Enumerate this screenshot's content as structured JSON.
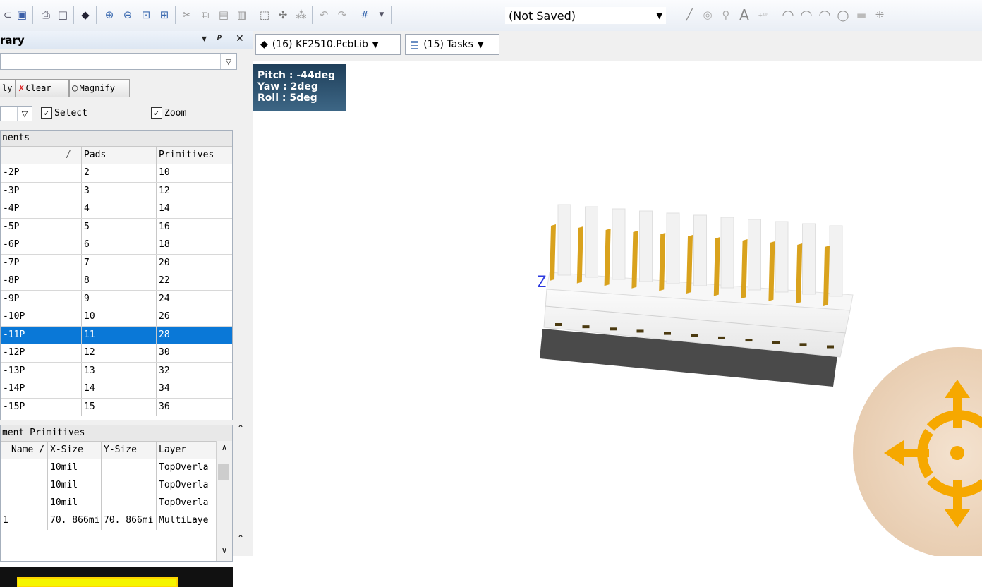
{
  "toolbar": {
    "saved_state": "(Not Saved)",
    "icons": [
      "open-icon",
      "save-icon",
      "print-icon",
      "print-preview-icon",
      "3d-body-icon",
      "zoom-in-icon",
      "zoom-out-icon",
      "zoom-fit-icon",
      "zoom-selected-icon",
      "cut-icon",
      "copy-icon",
      "paste-icon",
      "rubber-stamp-icon",
      "select-area-icon",
      "move-icon",
      "deselect-icon",
      "undo-icon",
      "redo-icon",
      "grid-icon",
      "line-icon",
      "pad-icon",
      "via-icon",
      "string-icon",
      "coordinate-icon",
      "arc-center-icon",
      "arc-edge-icon",
      "arc-any-icon",
      "circle-icon",
      "fill-icon",
      "array-paste-icon"
    ]
  },
  "panel": {
    "title": "rary",
    "buttons": {
      "apply": "ly",
      "clear": "Clear",
      "magnify": "Magnify"
    },
    "checks": {
      "select": "Select",
      "zoom": "Zoom"
    },
    "components": {
      "caption": "nents",
      "columns": [
        "",
        "Pads",
        "Primitives"
      ],
      "rows": [
        {
          "name": "-2P",
          "pads": "2",
          "prims": "10"
        },
        {
          "name": "-3P",
          "pads": "3",
          "prims": "12"
        },
        {
          "name": "-4P",
          "pads": "4",
          "prims": "14"
        },
        {
          "name": "-5P",
          "pads": "5",
          "prims": "16"
        },
        {
          "name": "-6P",
          "pads": "6",
          "prims": "18"
        },
        {
          "name": "-7P",
          "pads": "7",
          "prims": "20"
        },
        {
          "name": "-8P",
          "pads": "8",
          "prims": "22"
        },
        {
          "name": "-9P",
          "pads": "9",
          "prims": "24"
        },
        {
          "name": "-10P",
          "pads": "10",
          "prims": "26"
        },
        {
          "name": "-11P",
          "pads": "11",
          "prims": "28",
          "selected": true
        },
        {
          "name": "-12P",
          "pads": "12",
          "prims": "30"
        },
        {
          "name": "-13P",
          "pads": "13",
          "prims": "32"
        },
        {
          "name": "-14P",
          "pads": "14",
          "prims": "34"
        },
        {
          "name": "-15P",
          "pads": "15",
          "prims": "36"
        }
      ]
    },
    "primitives": {
      "caption": "ment Primitives",
      "columns": [
        "Name /",
        "X-Size",
        "Y-Size",
        "Layer"
      ],
      "rows": [
        {
          "name": "",
          "x": "10mil",
          "y": "",
          "layer": "TopOverla"
        },
        {
          "name": "",
          "x": "10mil",
          "y": "",
          "layer": "TopOverla"
        },
        {
          "name": "",
          "x": "10mil",
          "y": "",
          "layer": "TopOverla"
        },
        {
          "name": "1",
          "x": "70. 866mi",
          "y": "70. 866mi",
          "layer": "MultiLaye"
        }
      ]
    }
  },
  "tabs": {
    "pcblib": "(16) KF2510.PcbLib",
    "tasks": "(15) Tasks"
  },
  "viewport": {
    "pitch": "Pitch : -44deg",
    "yaw": "Yaw : 2deg",
    "roll": "Roll : 5deg",
    "axis_label": "Z"
  },
  "colors": {
    "selection": "#0a78d7",
    "pin_gold": "#d9a21d",
    "nav_orange": "#f6a800",
    "orient_bg": "#2b506f"
  }
}
